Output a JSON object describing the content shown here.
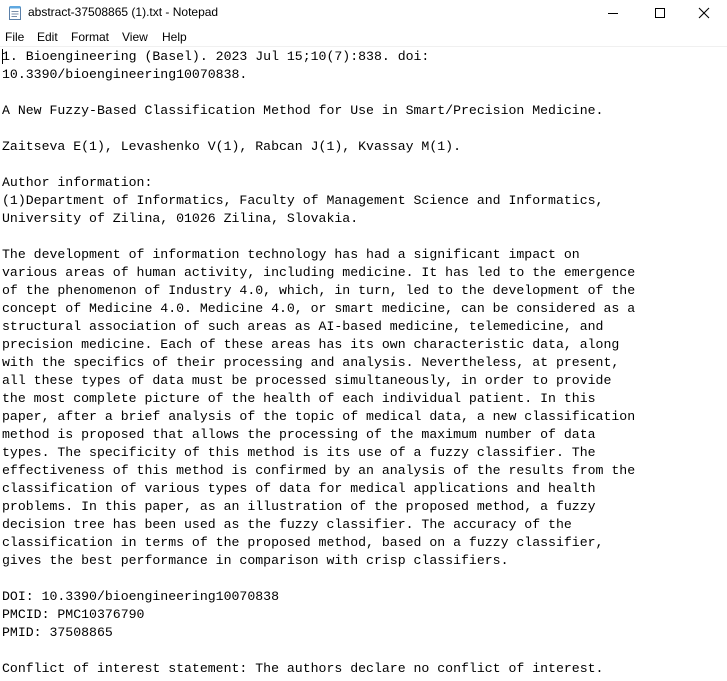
{
  "window": {
    "title": "abstract-37508865 (1).txt - Notepad",
    "icons": [
      "notepad-icon",
      "minimize-icon",
      "maximize-icon",
      "close-icon"
    ]
  },
  "menu": {
    "items": [
      "File",
      "Edit",
      "Format",
      "View",
      "Help"
    ]
  },
  "editor": {
    "lines": [
      "1. Bioengineering (Basel). 2023 Jul 15;10(7):838. doi:",
      "10.3390/bioengineering10070838.",
      "",
      "A New Fuzzy-Based Classification Method for Use in Smart/Precision Medicine.",
      "",
      "Zaitseva E(1), Levashenko V(1), Rabcan J(1), Kvassay M(1).",
      "",
      "Author information:",
      "(1)Department of Informatics, Faculty of Management Science and Informatics,",
      "University of Zilina, 01026 Zilina, Slovakia.",
      "",
      "The development of information technology has had a significant impact on",
      "various areas of human activity, including medicine. It has led to the emergence",
      "of the phenomenon of Industry 4.0, which, in turn, led to the development of the",
      "concept of Medicine 4.0. Medicine 4.0, or smart medicine, can be considered as a",
      "structural association of such areas as AI-based medicine, telemedicine, and",
      "precision medicine. Each of these areas has its own characteristic data, along",
      "with the specifics of their processing and analysis. Nevertheless, at present,",
      "all these types of data must be processed simultaneously, in order to provide",
      "the most complete picture of the health of each individual patient. In this",
      "paper, after a brief analysis of the topic of medical data, a new classification",
      "method is proposed that allows the processing of the maximum number of data",
      "types. The specificity of this method is its use of a fuzzy classifier. The",
      "effectiveness of this method is confirmed by an analysis of the results from the",
      "classification of various types of data for medical applications and health",
      "problems. In this paper, as an illustration of the proposed method, a fuzzy",
      "decision tree has been used as the fuzzy classifier. The accuracy of the",
      "classification in terms of the proposed method, based on a fuzzy classifier,",
      "gives the best performance in comparison with crisp classifiers.",
      "",
      "DOI: 10.3390/bioengineering10070838",
      "PMCID: PMC10376790",
      "PMID: 37508865",
      "",
      "Conflict of interest statement: The authors declare no conflict of interest."
    ]
  }
}
